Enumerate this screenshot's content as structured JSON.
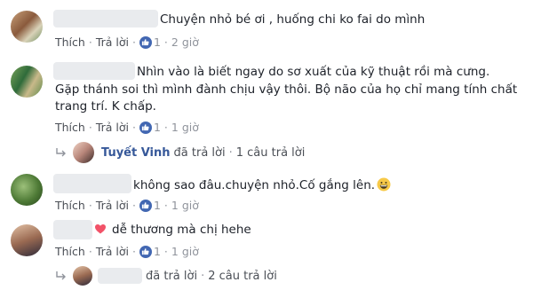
{
  "comments": [
    {
      "text": "Chuyện nhỏ bé ơi , huống chi ko fai do mình",
      "like": "Thích",
      "reply": "Trả lời",
      "likes": "1",
      "time": "2 giờ"
    },
    {
      "text_line1": "Nhìn vào là biết ngay do sơ xuất của kỹ thuật rồi mà cưng.",
      "text_line2": "Gặp thánh soi thì mình đành chịu vậy thôi. Bộ não của họ chỉ mang tính chất",
      "text_line3": "trang trí. K chấp.",
      "like": "Thích",
      "reply": "Trả lời",
      "likes": "1",
      "time": "1 giờ",
      "reply_summary": {
        "name": "Tuyết Vinh",
        "action": "đã trả lời",
        "count": "1 câu trả lời"
      }
    },
    {
      "text": "không sao đâu.chuyện nhỏ.Cố gắng lên.",
      "like": "Thích",
      "reply": "Trả lời",
      "likes": "1",
      "time": "1 giờ"
    },
    {
      "text": "dễ thương mà chị hehe",
      "like": "Thích",
      "reply": "Trả lời",
      "likes": "1",
      "time": "1 giờ",
      "reply_summary": {
        "action": "đã trả lời",
        "count": "2 câu trả lời"
      }
    }
  ],
  "colors": {
    "link": "#4b4f56",
    "name": "#365899",
    "muted": "#90949c",
    "like_badge": "#4267b2",
    "heart": "#f25268"
  }
}
